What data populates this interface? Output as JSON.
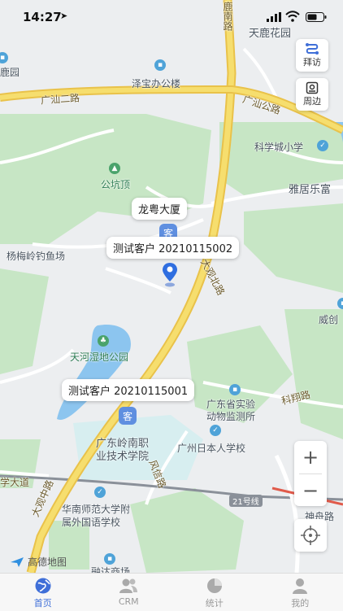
{
  "status_bar": {
    "time": "14:27"
  },
  "map": {
    "labels": {
      "tianlu": "天鹿花园",
      "luhe": "鹿南路",
      "jiaoqu": "泽宝办公楼",
      "guangshan2": "广汕二路",
      "guangshan": "广汕公路",
      "kexue_school": "科学城小学",
      "gongjiding": "公坑顶",
      "yajule": "雅居乐富",
      "yangmei": "杨梅岭钓鱼场",
      "tianhe_park": "天河湿地公园",
      "daguan_n": "大观北路",
      "weichuang": "威创",
      "kexiang": "科翔路",
      "guangdong_lab": "广东省实验\n动物监测所",
      "lingnan": "广东岭南职\n业技术学院",
      "japan_school": "广州日本人学校",
      "fengxin": "风信路",
      "daguan_zhong": "大观中路",
      "dadao": "学大道",
      "huanan": "华南师范大学附\n属外国语学校",
      "line21": "21号线",
      "shenzhou": "神舟路",
      "bottom_cut": "融达商场",
      "left_top": "鹿园"
    },
    "bubbles": {
      "longyue": "龙粤大厦",
      "customer2": "测试客户 20210115002",
      "customer1": "测试客户 20210115001"
    },
    "marker_char": "客",
    "side_buttons": {
      "visit": "拜访",
      "nearby": "周边"
    },
    "zoom": {
      "in": "+",
      "out": "−"
    },
    "provider_logo": "高德地图"
  },
  "tabbar": {
    "items": [
      {
        "label": "首页",
        "icon": "globe-icon",
        "active": true
      },
      {
        "label": "CRM",
        "icon": "users-icon",
        "active": false
      },
      {
        "label": "统计",
        "icon": "pie-chart-icon",
        "active": false
      },
      {
        "label": "我的",
        "icon": "person-icon",
        "active": false
      }
    ]
  },
  "colors": {
    "accent": "#3f6fd8",
    "road_main": "#f2d15a",
    "green_area": "#c4e5c3",
    "water": "#8bc6f0"
  }
}
